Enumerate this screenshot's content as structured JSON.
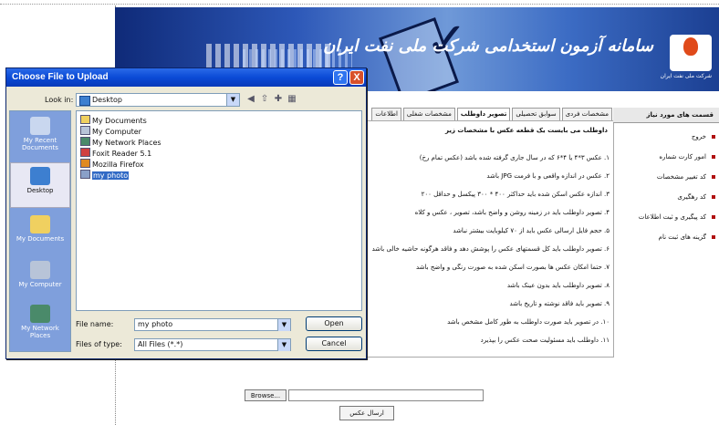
{
  "banner": {
    "title": "سامانه آزمون استخدامی شرکت ملی نفت ایران",
    "logo_text": "شرکت ملی نفت ایران"
  },
  "tabs": [
    {
      "label": "مشخصات فردی",
      "active": false
    },
    {
      "label": "سوابق تحصیلی",
      "active": false
    },
    {
      "label": "تصویر داوطلب",
      "active": true
    },
    {
      "label": "مشخصات شغلی",
      "active": false
    },
    {
      "label": "اطلاعات",
      "active": false
    }
  ],
  "content": {
    "intro": "داوطلب می بایست یک قطعه عکس با مشخصات زیر",
    "rules": [
      "۱. عکس ۳*۴ یا ۴*۶ که در سال جاری گرفته شده باشد (عکس تمام رخ)",
      "۲. عکس در اندازه واقعی و با فرمت JPG باشد",
      "۳. اندازه عکس اسکن شده باید حداکثر ۴۰۰ * ۳۰۰ پیکسل و حداقل ۲۰۰",
      "۴. تصویر داوطلب باید در زمینه روشن و واضح باشد، تصویر ، عکس و کلاه",
      "۵. حجم فایل ارسالی عکس باید از ۷۰ کیلوبایت بیشتر نباشد",
      "۶. تصویر داوطلب باید کل قسمتهای عکس را پوشش دهد و فاقد هرگونه حاشیه خالی باشد",
      "۷. حتما امکان عکس ها بصورت اسکن شده به صورت رنگی و واضح باشد",
      "۸. تصویر داوطلب باید بدون عینک باشد",
      "۹. تصویر باید فاقد نوشته و تاریخ باشد",
      "۱۰. در تصویر باید صورت داوطلب به طور کامل مشخص باشد",
      "۱۱. داوطلب باید مسئولیت صحت عکس را بپذیرد"
    ]
  },
  "sidebar": {
    "heading": "قسمت های مورد نیاز",
    "items": [
      "خروج",
      "امور کارت شماره",
      "کد تغییر مشخصات",
      "کد رهگیری",
      "کد پیگیری و ثبت اطلاعات",
      "گزینه های ثبت نام"
    ]
  },
  "browse": {
    "button_label": "Browse...",
    "field_value": "",
    "send_label": "ارسال عکس"
  },
  "dialog": {
    "title": "Choose File to Upload",
    "look_in_label": "Look in:",
    "look_in_value": "Desktop",
    "places": [
      {
        "label": "My Recent Documents",
        "icon": "recent-documents-icon"
      },
      {
        "label": "Desktop",
        "icon": "desktop-icon"
      },
      {
        "label": "My Documents",
        "icon": "my-documents-icon"
      },
      {
        "label": "My Computer",
        "icon": "my-computer-icon"
      },
      {
        "label": "My Network Places",
        "icon": "network-places-icon"
      }
    ],
    "files": [
      {
        "name": "My Documents",
        "icon": "folder-icon",
        "selected": false
      },
      {
        "name": "My Computer",
        "icon": "computer-icon",
        "selected": false
      },
      {
        "name": "My Network Places",
        "icon": "network-icon",
        "selected": false
      },
      {
        "name": "Foxit Reader 5.1",
        "icon": "app-shortcut-icon",
        "selected": false
      },
      {
        "name": "Mozilla Firefox",
        "icon": "firefox-icon",
        "selected": false
      },
      {
        "name": "my photo",
        "icon": "image-file-icon",
        "selected": true
      }
    ],
    "file_name_label": "File name:",
    "file_name_value": "my photo",
    "file_type_label": "Files of type:",
    "file_type_value": "All Files (*.*)",
    "open_label": "Open",
    "cancel_label": "Cancel",
    "help_glyph": "?",
    "close_glyph": "X"
  },
  "colors": {
    "titlebar": "#0a4ad6",
    "selection": "#316ac5",
    "places_bar": "#7f9fdc",
    "dialog_face": "#ece9d8"
  }
}
